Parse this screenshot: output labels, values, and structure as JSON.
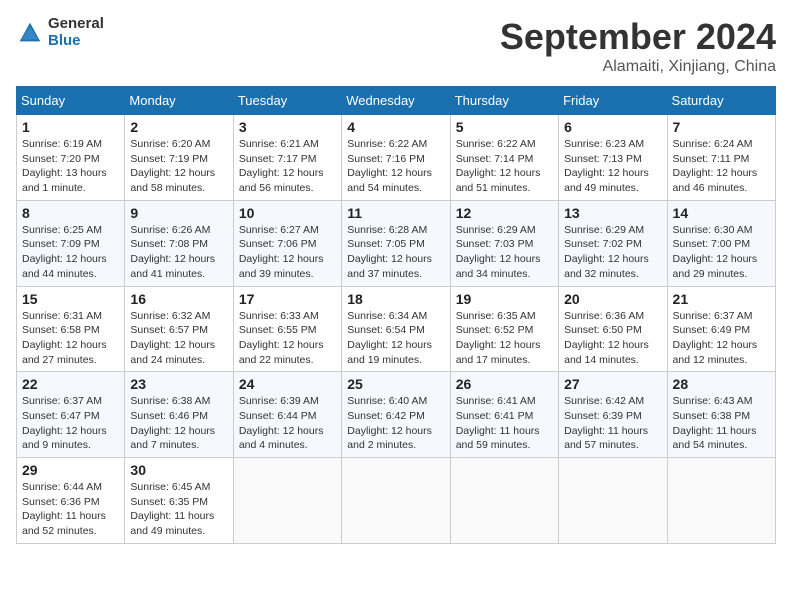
{
  "logo": {
    "general": "General",
    "blue": "Blue"
  },
  "header": {
    "month": "September 2024",
    "location": "Alamaiti, Xinjiang, China"
  },
  "weekdays": [
    "Sunday",
    "Monday",
    "Tuesday",
    "Wednesday",
    "Thursday",
    "Friday",
    "Saturday"
  ],
  "weeks": [
    [
      {
        "day": 1,
        "info": "Sunrise: 6:19 AM\nSunset: 7:20 PM\nDaylight: 13 hours\nand 1 minute."
      },
      {
        "day": 2,
        "info": "Sunrise: 6:20 AM\nSunset: 7:19 PM\nDaylight: 12 hours\nand 58 minutes."
      },
      {
        "day": 3,
        "info": "Sunrise: 6:21 AM\nSunset: 7:17 PM\nDaylight: 12 hours\nand 56 minutes."
      },
      {
        "day": 4,
        "info": "Sunrise: 6:22 AM\nSunset: 7:16 PM\nDaylight: 12 hours\nand 54 minutes."
      },
      {
        "day": 5,
        "info": "Sunrise: 6:22 AM\nSunset: 7:14 PM\nDaylight: 12 hours\nand 51 minutes."
      },
      {
        "day": 6,
        "info": "Sunrise: 6:23 AM\nSunset: 7:13 PM\nDaylight: 12 hours\nand 49 minutes."
      },
      {
        "day": 7,
        "info": "Sunrise: 6:24 AM\nSunset: 7:11 PM\nDaylight: 12 hours\nand 46 minutes."
      }
    ],
    [
      {
        "day": 8,
        "info": "Sunrise: 6:25 AM\nSunset: 7:09 PM\nDaylight: 12 hours\nand 44 minutes."
      },
      {
        "day": 9,
        "info": "Sunrise: 6:26 AM\nSunset: 7:08 PM\nDaylight: 12 hours\nand 41 minutes."
      },
      {
        "day": 10,
        "info": "Sunrise: 6:27 AM\nSunset: 7:06 PM\nDaylight: 12 hours\nand 39 minutes."
      },
      {
        "day": 11,
        "info": "Sunrise: 6:28 AM\nSunset: 7:05 PM\nDaylight: 12 hours\nand 37 minutes."
      },
      {
        "day": 12,
        "info": "Sunrise: 6:29 AM\nSunset: 7:03 PM\nDaylight: 12 hours\nand 34 minutes."
      },
      {
        "day": 13,
        "info": "Sunrise: 6:29 AM\nSunset: 7:02 PM\nDaylight: 12 hours\nand 32 minutes."
      },
      {
        "day": 14,
        "info": "Sunrise: 6:30 AM\nSunset: 7:00 PM\nDaylight: 12 hours\nand 29 minutes."
      }
    ],
    [
      {
        "day": 15,
        "info": "Sunrise: 6:31 AM\nSunset: 6:58 PM\nDaylight: 12 hours\nand 27 minutes."
      },
      {
        "day": 16,
        "info": "Sunrise: 6:32 AM\nSunset: 6:57 PM\nDaylight: 12 hours\nand 24 minutes."
      },
      {
        "day": 17,
        "info": "Sunrise: 6:33 AM\nSunset: 6:55 PM\nDaylight: 12 hours\nand 22 minutes."
      },
      {
        "day": 18,
        "info": "Sunrise: 6:34 AM\nSunset: 6:54 PM\nDaylight: 12 hours\nand 19 minutes."
      },
      {
        "day": 19,
        "info": "Sunrise: 6:35 AM\nSunset: 6:52 PM\nDaylight: 12 hours\nand 17 minutes."
      },
      {
        "day": 20,
        "info": "Sunrise: 6:36 AM\nSunset: 6:50 PM\nDaylight: 12 hours\nand 14 minutes."
      },
      {
        "day": 21,
        "info": "Sunrise: 6:37 AM\nSunset: 6:49 PM\nDaylight: 12 hours\nand 12 minutes."
      }
    ],
    [
      {
        "day": 22,
        "info": "Sunrise: 6:37 AM\nSunset: 6:47 PM\nDaylight: 12 hours\nand 9 minutes."
      },
      {
        "day": 23,
        "info": "Sunrise: 6:38 AM\nSunset: 6:46 PM\nDaylight: 12 hours\nand 7 minutes."
      },
      {
        "day": 24,
        "info": "Sunrise: 6:39 AM\nSunset: 6:44 PM\nDaylight: 12 hours\nand 4 minutes."
      },
      {
        "day": 25,
        "info": "Sunrise: 6:40 AM\nSunset: 6:42 PM\nDaylight: 12 hours\nand 2 minutes."
      },
      {
        "day": 26,
        "info": "Sunrise: 6:41 AM\nSunset: 6:41 PM\nDaylight: 11 hours\nand 59 minutes."
      },
      {
        "day": 27,
        "info": "Sunrise: 6:42 AM\nSunset: 6:39 PM\nDaylight: 11 hours\nand 57 minutes."
      },
      {
        "day": 28,
        "info": "Sunrise: 6:43 AM\nSunset: 6:38 PM\nDaylight: 11 hours\nand 54 minutes."
      }
    ],
    [
      {
        "day": 29,
        "info": "Sunrise: 6:44 AM\nSunset: 6:36 PM\nDaylight: 11 hours\nand 52 minutes."
      },
      {
        "day": 30,
        "info": "Sunrise: 6:45 AM\nSunset: 6:35 PM\nDaylight: 11 hours\nand 49 minutes."
      },
      null,
      null,
      null,
      null,
      null
    ]
  ]
}
